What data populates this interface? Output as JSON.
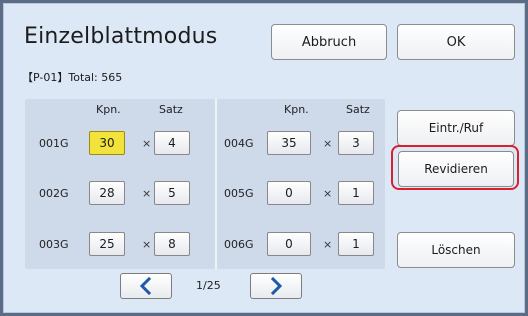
{
  "window": {
    "title": "Einzelblattmodus"
  },
  "top_buttons": {
    "cancel": "Abbruch",
    "ok": "OK"
  },
  "summary": {
    "job_id": "【P-01】",
    "total": "Total: 565"
  },
  "table": {
    "left_headers": {
      "copies": "Kpn.",
      "sets": "Satz"
    },
    "right_headers": {
      "copies": "Kpn.",
      "sets": "Satz"
    },
    "times": "×",
    "rows": [
      {
        "label": "001G",
        "copies": "30",
        "sets": "4",
        "selected": true
      },
      {
        "label": "002G",
        "copies": "28",
        "sets": "5"
      },
      {
        "label": "003G",
        "copies": "25",
        "sets": "8"
      },
      {
        "label": "004G",
        "copies": "35",
        "sets": "3"
      },
      {
        "label": "005G",
        "copies": "0",
        "sets": "1"
      },
      {
        "label": "006G",
        "copies": "0",
        "sets": "1"
      }
    ]
  },
  "side_buttons": {
    "store_recall": "Eintr./Ruf",
    "revise": "Revidieren",
    "delete": "Löschen"
  },
  "pagination": {
    "page": "1/25",
    "prev_icon": "chevron-left-icon",
    "next_icon": "chevron-right-icon"
  },
  "colors": {
    "background": "#dde8f6",
    "selected": "#f1e33a",
    "highlight": "#d8202f",
    "chevron": "#1e5aa8"
  }
}
